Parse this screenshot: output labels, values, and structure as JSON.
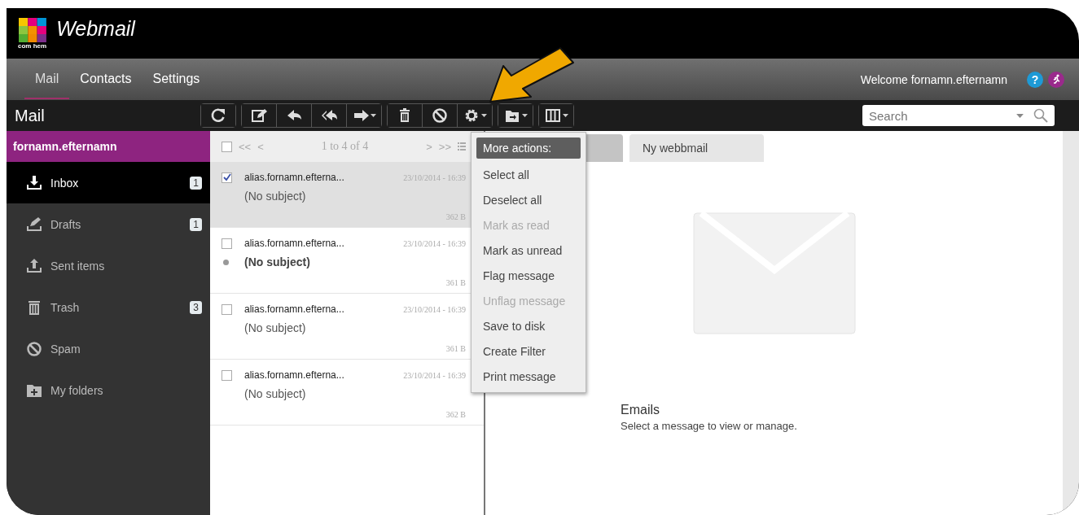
{
  "app": {
    "title": "Webmail",
    "logo_text": "com hem"
  },
  "nav": {
    "tabs": [
      {
        "label": "Mail",
        "selected": true
      },
      {
        "label": "Contacts",
        "selected": false
      },
      {
        "label": "Settings",
        "selected": false
      }
    ],
    "welcome": "Welcome fornamn.efternamn",
    "help": "?"
  },
  "toolbar": {
    "title": "Mail",
    "search": {
      "placeholder": "Search"
    }
  },
  "sidebar": {
    "account": "fornamn.efternamn",
    "items": [
      {
        "kind": "inbox",
        "label": "Inbox",
        "count": "1",
        "selected": true
      },
      {
        "kind": "drafts",
        "label": "Drafts",
        "count": "1",
        "selected": false
      },
      {
        "kind": "sent",
        "label": "Sent items",
        "selected": false
      },
      {
        "kind": "trash",
        "label": "Trash",
        "count": "3",
        "selected": false
      },
      {
        "kind": "spam",
        "label": "Spam",
        "selected": false
      },
      {
        "kind": "folders",
        "label": "My folders",
        "selected": false
      }
    ]
  },
  "message_list": {
    "select_all": {
      "checked": false
    },
    "pager": {
      "first": "<<",
      "prev": "<",
      "range": "1 to 4 of 4",
      "next": ">",
      "last": ">>"
    },
    "messages": [
      {
        "from": "alias.fornamn.efterna...",
        "date": "23/10/2014 - 16:39",
        "subject": "(No subject)",
        "size": "362 B",
        "checked": true,
        "selected": true,
        "unread": false
      },
      {
        "from": "alias.fornamn.efterna...",
        "date": "23/10/2014 - 16:39",
        "subject": "(No subject)",
        "size": "361 B",
        "checked": false,
        "selected": false,
        "unread": true
      },
      {
        "from": "alias.fornamn.efterna...",
        "date": "23/10/2014 - 16:39",
        "subject": "(No subject)",
        "size": "361 B",
        "checked": false,
        "selected": false,
        "unread": false
      },
      {
        "from": "alias.fornamn.efterna...",
        "date": "23/10/2014 - 16:39",
        "subject": "(No subject)",
        "size": "362 B",
        "checked": false,
        "selected": false,
        "unread": false
      }
    ]
  },
  "more_actions_menu": {
    "header": "More actions:",
    "items": [
      {
        "label": "Select all",
        "disabled": false
      },
      {
        "label": "Deselect all",
        "disabled": false
      },
      {
        "label": "Mark as read",
        "disabled": true
      },
      {
        "label": "Mark as unread",
        "disabled": false
      },
      {
        "label": "Flag message",
        "disabled": false
      },
      {
        "label": "Unflag message",
        "disabled": true
      },
      {
        "label": "Save to disk",
        "disabled": false
      },
      {
        "label": "Create Filter",
        "disabled": false
      },
      {
        "label": "Print message",
        "disabled": false
      }
    ]
  },
  "preview": {
    "tabs": [
      {
        "selected": true
      },
      {
        "label": "Ny webbmail",
        "selected": false
      }
    ],
    "title": "Emails",
    "hint": "Select a message to view or manage."
  }
}
